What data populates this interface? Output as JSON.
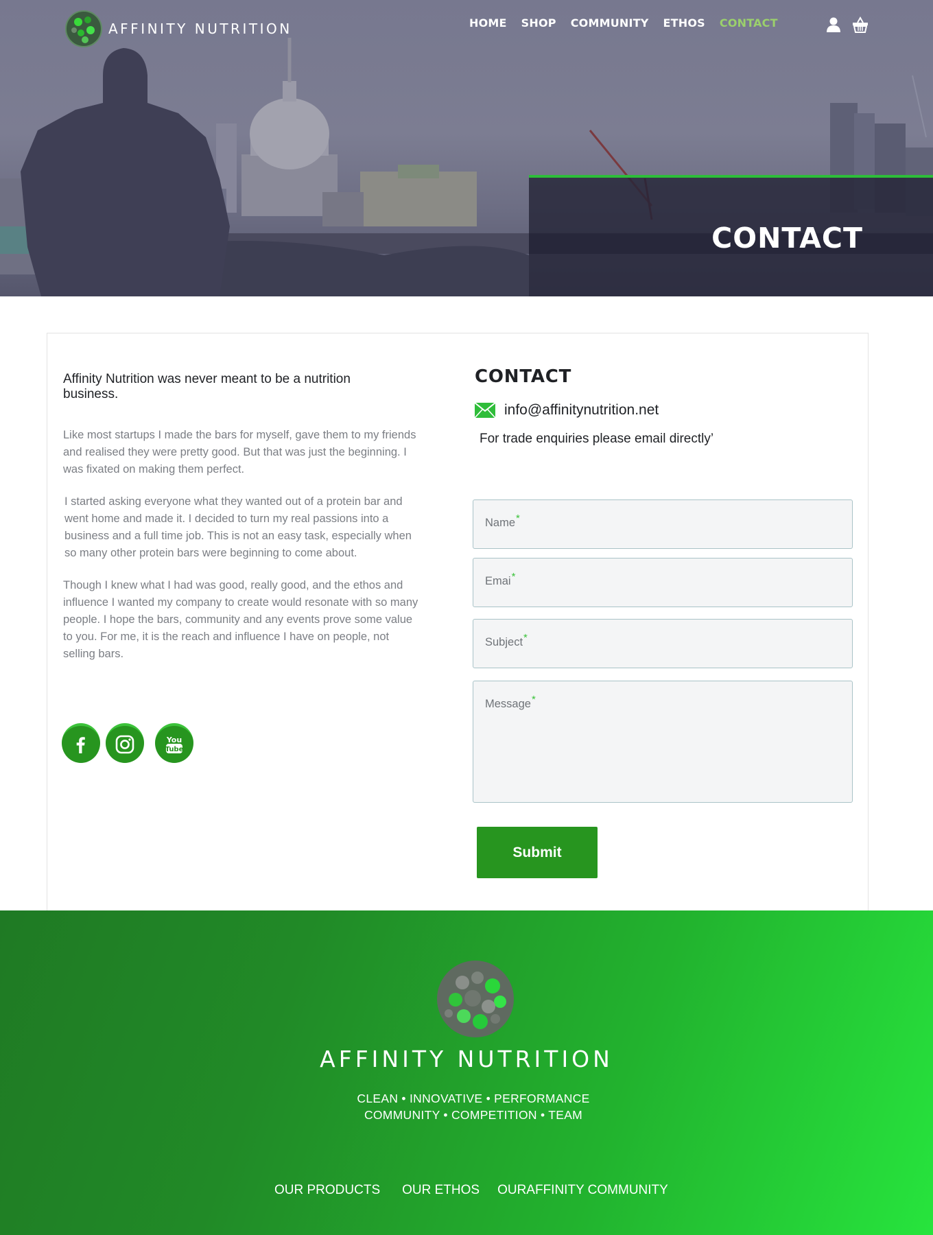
{
  "brand": {
    "name": "AFFINITY NUTRITION"
  },
  "nav": {
    "items": [
      {
        "label": "HOME",
        "active": false
      },
      {
        "label": "SHOP",
        "active": false
      },
      {
        "label": "COMMUNITY",
        "active": false
      },
      {
        "label": "ETHOS",
        "active": false
      },
      {
        "label": "CONTACT",
        "active": true
      }
    ],
    "icons": [
      "user-icon",
      "basket-icon"
    ]
  },
  "hero": {
    "title": "CONTACT"
  },
  "about": {
    "intro": "Affinity Nutrition was never meant to be a nutrition business.",
    "paragraphs": [
      "Like most startups I made the bars for myself, gave them to my friends and realised they were pretty good. But that was just the beginning. I was fixated on making them perfect.",
      "I started asking everyone what they wanted out of a protein bar and went home and made it. I decided to turn my real passions into a business and a full time job. This is not an easy task, especially when so many other protein bars were beginning to come about.",
      "Though I knew what I had was good, really good, and the ethos and influence I wanted my company to create would resonate with so many people. I hope the bars, community and any events prove some value to you. For me, it is the reach and influence I have on people, not selling bars."
    ],
    "social": [
      "facebook-icon",
      "instagram-icon",
      "youtube-icon"
    ]
  },
  "contact": {
    "heading": "CONTACT",
    "email": "info@affinitynutrition.net",
    "trade_note": "For trade enquiries please email directly’",
    "fields": {
      "name": "Name",
      "email": "Emai",
      "subject": "Subject",
      "message": "Message",
      "required_mark": "*"
    },
    "submit_label": "Submit"
  },
  "footer": {
    "brand": "AFFINITY NUTRITION",
    "tagline_1": "CLEAN • INNOVATIVE • PERFORMANCE",
    "tagline_2": "COMMUNITY • COMPETITION • TEAM",
    "links": [
      "OUR PRODUCTS",
      "OUR ETHOS",
      "OURAFFINITY COMMUNITY"
    ]
  },
  "colors": {
    "accent_green": "#27951f",
    "nav_active": "#9bd06c",
    "required_star": "#3ac23a",
    "hero_panel": "#262638"
  }
}
